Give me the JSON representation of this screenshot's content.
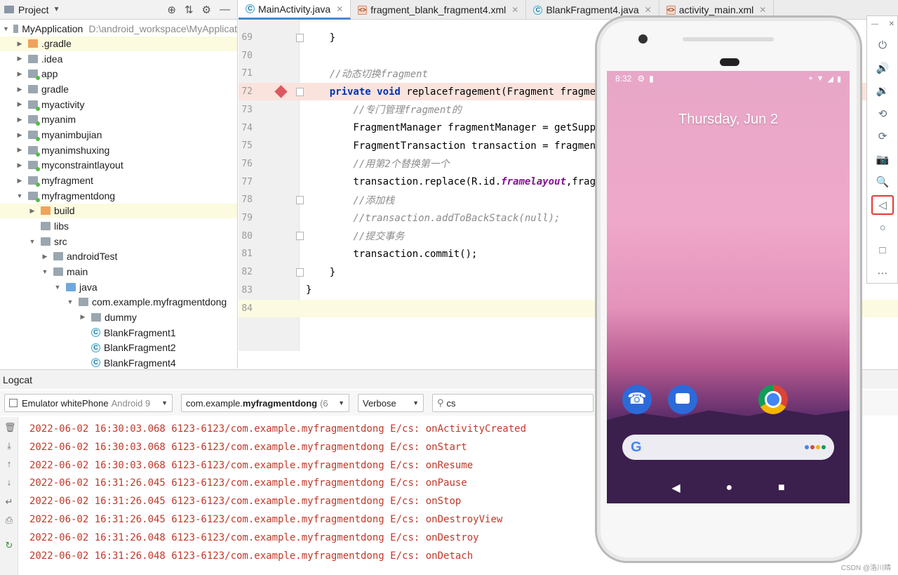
{
  "project_panel": {
    "title": "Project",
    "tree": [
      {
        "label": "MyApplication",
        "note": "D:\\android_workspace\\MyApplicat",
        "depth": 0,
        "arrow": "▼",
        "icon": "folder",
        "highlight": false
      },
      {
        "label": ".gradle",
        "depth": 1,
        "arrow": "▶",
        "icon": "folder-orange",
        "highlight": true
      },
      {
        "label": ".idea",
        "depth": 1,
        "arrow": "▶",
        "icon": "folder",
        "highlight": false
      },
      {
        "label": "app",
        "depth": 1,
        "arrow": "▶",
        "icon": "module",
        "highlight": false
      },
      {
        "label": "gradle",
        "depth": 1,
        "arrow": "▶",
        "icon": "folder",
        "highlight": false
      },
      {
        "label": "myactivity",
        "depth": 1,
        "arrow": "▶",
        "icon": "module",
        "highlight": false
      },
      {
        "label": "myanim",
        "depth": 1,
        "arrow": "▶",
        "icon": "module",
        "highlight": false
      },
      {
        "label": "myanimbujian",
        "depth": 1,
        "arrow": "▶",
        "icon": "module",
        "highlight": false
      },
      {
        "label": "myanimshuxing",
        "depth": 1,
        "arrow": "▶",
        "icon": "module",
        "highlight": false
      },
      {
        "label": "myconstraintlayout",
        "depth": 1,
        "arrow": "▶",
        "icon": "module",
        "highlight": false
      },
      {
        "label": "myfragment",
        "depth": 1,
        "arrow": "▶",
        "icon": "module",
        "highlight": false
      },
      {
        "label": "myfragmentdong",
        "depth": 1,
        "arrow": "▼",
        "icon": "module",
        "highlight": false
      },
      {
        "label": "build",
        "depth": 2,
        "arrow": "▶",
        "icon": "folder-orange",
        "highlight": true
      },
      {
        "label": "libs",
        "depth": 2,
        "arrow": "",
        "icon": "folder",
        "highlight": false
      },
      {
        "label": "src",
        "depth": 2,
        "arrow": "▼",
        "icon": "folder",
        "highlight": false
      },
      {
        "label": "androidTest",
        "depth": 3,
        "arrow": "▶",
        "icon": "folder",
        "highlight": false
      },
      {
        "label": "main",
        "depth": 3,
        "arrow": "▼",
        "icon": "folder",
        "highlight": false
      },
      {
        "label": "java",
        "depth": 4,
        "arrow": "▼",
        "icon": "folder-blue",
        "highlight": false
      },
      {
        "label": "com.example.myfragmentdong",
        "depth": 5,
        "arrow": "▼",
        "icon": "folder",
        "highlight": false
      },
      {
        "label": "dummy",
        "depth": 6,
        "arrow": "▶",
        "icon": "folder",
        "highlight": false
      },
      {
        "label": "BlankFragment1",
        "depth": 6,
        "arrow": "",
        "icon": "class",
        "highlight": false
      },
      {
        "label": "BlankFragment2",
        "depth": 6,
        "arrow": "",
        "icon": "class",
        "highlight": false
      },
      {
        "label": "BlankFragment4",
        "depth": 6,
        "arrow": "",
        "icon": "class",
        "highlight": false
      }
    ]
  },
  "tabs": [
    {
      "label": "MainActivity.java",
      "icon": "C",
      "kind": "java",
      "active": true
    },
    {
      "label": "fragment_blank_fragment4.xml",
      "icon": "<>",
      "kind": "xml",
      "active": false
    },
    {
      "label": "BlankFragment4.java",
      "icon": "C",
      "kind": "java",
      "active": false
    },
    {
      "label": "activity_main.xml",
      "icon": "<>",
      "kind": "xml",
      "active": false
    }
  ],
  "editor": {
    "lines": [
      {
        "n": "69",
        "text": "    }",
        "style": "plain",
        "fold": true
      },
      {
        "n": "70",
        "text": "",
        "style": "plain"
      },
      {
        "n": "71",
        "text": "    //动态切换fragment",
        "style": "comment"
      },
      {
        "n": "72",
        "text_kw": "    private void ",
        "text": "replacefragement(Fragment fragme",
        "style": "kw",
        "breakpoint": true,
        "fold": true
      },
      {
        "n": "73",
        "text": "        //专门管理fragment的",
        "style": "comment"
      },
      {
        "n": "74",
        "text": "        FragmentManager fragmentManager = getSuppo",
        "style": "plain"
      },
      {
        "n": "75",
        "text": "        FragmentTransaction transaction = fragment",
        "style": "plain"
      },
      {
        "n": "76",
        "text": "        //用第2个替换第一个",
        "style": "comment"
      },
      {
        "n": "77",
        "text": "        transaction.replace(R.id.",
        "text_field": "framelayout",
        "text_after": ",frag",
        "style": "field"
      },
      {
        "n": "78",
        "text": "        //添加栈",
        "style": "comment",
        "fold": true
      },
      {
        "n": "79",
        "text": "        //transaction.addToBackStack(null);",
        "style": "comment"
      },
      {
        "n": "80",
        "text": "        //提交事务",
        "style": "comment",
        "fold": true
      },
      {
        "n": "81",
        "text": "        transaction.commit();",
        "style": "plain"
      },
      {
        "n": "82",
        "text": "    }",
        "style": "plain",
        "fold": true
      },
      {
        "n": "83",
        "text": "}",
        "style": "plain"
      },
      {
        "n": "84",
        "text": "",
        "style": "plain",
        "current": true
      }
    ]
  },
  "logcat": {
    "title": "Logcat",
    "device": {
      "name": "Emulator whitePhone",
      "suffix": "Android 9"
    },
    "package": {
      "prefix": "com.example.",
      "bold": "myfragmentdong",
      "suffix": "(6"
    },
    "level": "Verbose",
    "search": "cs",
    "lines": [
      "2022-06-02 16:30:03.068 6123-6123/com.example.myfragmentdong E/cs: onActivityCreated",
      "2022-06-02 16:30:03.068 6123-6123/com.example.myfragmentdong E/cs: onStart",
      "2022-06-02 16:30:03.068 6123-6123/com.example.myfragmentdong E/cs: onResume",
      "2022-06-02 16:31:26.045 6123-6123/com.example.myfragmentdong E/cs: onPause",
      "2022-06-02 16:31:26.045 6123-6123/com.example.myfragmentdong E/cs: onStop",
      "2022-06-02 16:31:26.045 6123-6123/com.example.myfragmentdong E/cs: onDestroyView",
      "2022-06-02 16:31:26.048 6123-6123/com.example.myfragmentdong E/cs: onDestroy",
      "2022-06-02 16:31:26.048 6123-6123/com.example.myfragmentdong E/cs: onDetach"
    ]
  },
  "phone": {
    "time": "8:32",
    "date": "Thursday, Jun 2"
  },
  "emulator_toolbar": [
    {
      "name": "power-icon",
      "glyph": "⏻"
    },
    {
      "name": "volume-up-icon",
      "glyph": "🔊"
    },
    {
      "name": "volume-down-icon",
      "glyph": "🔉"
    },
    {
      "name": "rotate-left-icon",
      "glyph": "⟲"
    },
    {
      "name": "rotate-right-icon",
      "glyph": "⟳"
    },
    {
      "name": "camera-icon",
      "glyph": "📷"
    },
    {
      "name": "zoom-icon",
      "glyph": "🔍"
    },
    {
      "name": "back-icon",
      "glyph": "◁",
      "selected": true
    },
    {
      "name": "home-icon",
      "glyph": "○"
    },
    {
      "name": "overview-icon",
      "glyph": "□"
    },
    {
      "name": "more-icon",
      "glyph": "⋯"
    }
  ],
  "watermark": "CSDN @洛川晴",
  "colors": {
    "log_error": "#c0392b",
    "accent": "#4a88c7",
    "breakpoint": "#db5860"
  }
}
